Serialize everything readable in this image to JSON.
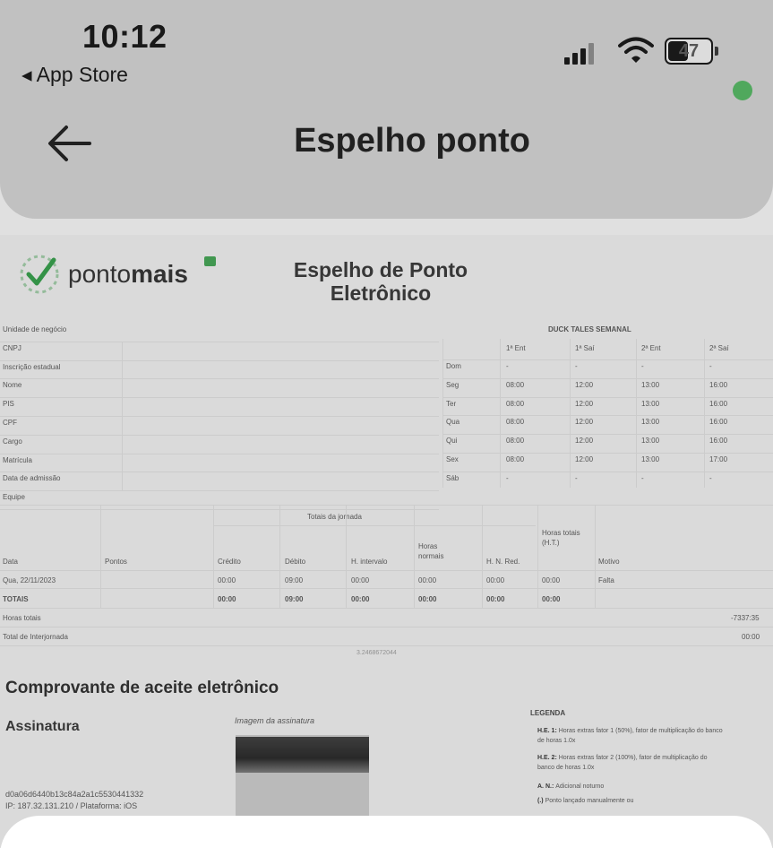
{
  "status_bar": {
    "time": "10:12",
    "battery": "47",
    "back_app": "◂ App Store"
  },
  "header": {
    "title": "Espelho ponto"
  },
  "document": {
    "logo": {
      "text_regular": "ponto",
      "text_bold": "mais"
    },
    "title_line1": "Espelho de Ponto",
    "title_line2": "Eletrônico",
    "employee_labels": [
      "Unidade de negócio",
      "CNPJ",
      "Inscrição estadual",
      "Nome",
      "PIS",
      "CPF",
      "Cargo",
      "Matrícula",
      "Data de admissão",
      "Equipe"
    ],
    "schedule": {
      "title": "DUCK TALES SEMANAL",
      "headers": [
        "1ª Ent",
        "1ª Saí",
        "2ª Ent",
        "2ª Saí"
      ],
      "rows": [
        {
          "day": "Dom",
          "values": [
            "-",
            "-",
            "-",
            "-"
          ]
        },
        {
          "day": "Seg",
          "values": [
            "08:00",
            "12:00",
            "13:00",
            "16:00"
          ]
        },
        {
          "day": "Ter",
          "values": [
            "08:00",
            "12:00",
            "13:00",
            "16:00"
          ]
        },
        {
          "day": "Qua",
          "values": [
            "08:00",
            "12:00",
            "13:00",
            "16:00"
          ]
        },
        {
          "day": "Qui",
          "values": [
            "08:00",
            "12:00",
            "13:00",
            "16:00"
          ]
        },
        {
          "day": "Sex",
          "values": [
            "08:00",
            "12:00",
            "13:00",
            "17:00"
          ]
        },
        {
          "day": "Sáb",
          "values": [
            "-",
            "-",
            "-",
            "-"
          ]
        }
      ]
    },
    "journey": {
      "group_title": "Totais da jornada",
      "headers": [
        "Data",
        "Pontos",
        "Crédito",
        "Débito",
        "H. intervalo",
        "Horas normais",
        "H. N. Red.",
        "Horas totais (H.T.)",
        "Motivo"
      ],
      "row": [
        "Qua, 22/11/2023",
        "",
        "00:00",
        "09:00",
        "00:00",
        "00:00",
        "00:00",
        "00:00",
        "Falta"
      ],
      "totals": [
        "TOTAIS",
        "",
        "00:00",
        "09:00",
        "00:00",
        "00:00",
        "00:00",
        "00:00",
        ""
      ],
      "total_hours_label": "Horas totais",
      "total_hours_value": "-7337:35",
      "interjourney_label": "Total de Interjornada",
      "interjourney_value": "00:00",
      "footer_code": "3.2468672044"
    },
    "acceptance": {
      "title": "Comprovante de aceite eletrônico",
      "signature_title": "Assinatura",
      "signature_image_label": "Imagem da assinatura",
      "hash": "d0a06d6440b13c84a2a1c5530441332",
      "ip": "IP: 187.32.131.210 / Plataforma: iOS",
      "legend_title": "LEGENDA",
      "legend": [
        {
          "key": "H.E. 1:",
          "text": "Horas extras fator 1 (50%), fator de multiplicação do banco de horas 1.0x"
        },
        {
          "key": "H.E. 2:",
          "text": "Horas extras fator 2 (100%), fator de multiplicação do banco de horas 1.0x"
        },
        {
          "key": "A. N.:",
          "text": "Adicional noturno"
        },
        {
          "key": "(.)",
          "text": "Ponto lançado manualmente ou"
        }
      ]
    }
  },
  "colors": {
    "header_bg": "#d0d0d0",
    "status_dot": "#4fb35e",
    "sheet": "#ffffff"
  }
}
